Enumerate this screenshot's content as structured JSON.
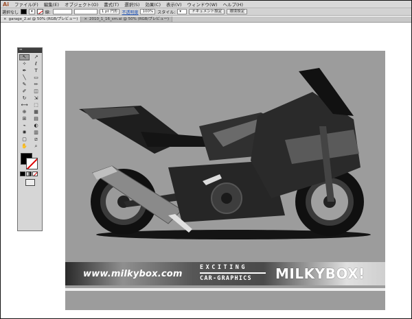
{
  "menubar": {
    "logo": "Ai",
    "items": [
      "ファイル(F)",
      "編集(E)",
      "オブジェクト(O)",
      "書式(T)",
      "選択(S)",
      "効果(C)",
      "表示(V)",
      "ウィンドウ(W)",
      "ヘルプ(H)"
    ]
  },
  "controlbar": {
    "selection_label": "選択なし",
    "stroke_label": "線:",
    "stroke_width": "1 pt 円形",
    "opacity_label": "不透明度",
    "opacity_value": "100%",
    "style_label": "スタイル:",
    "doc_setup_button": "ドキュメント設定",
    "preferences_button": "環境設定"
  },
  "tabs": [
    {
      "label": "garage_2.ai @ 50% (RGB/プレビュー)"
    },
    {
      "label": "2010_1_16_sm.ai @ 50% (RGB/プレビュー)"
    }
  ],
  "artwork": {
    "url": "www.milkybox.com",
    "tagline_1": "EXCITING",
    "tagline_2": "CAR-GRAPHICS",
    "brand": "MILKYBOX!"
  },
  "tools": [
    {
      "name": "selection-tool",
      "glyph": "↖"
    },
    {
      "name": "direct-selection-tool",
      "glyph": "↗"
    },
    {
      "name": "magic-wand-tool",
      "glyph": "✧"
    },
    {
      "name": "lasso-tool",
      "glyph": "ℓ"
    },
    {
      "name": "pen-tool",
      "glyph": "✒"
    },
    {
      "name": "type-tool",
      "glyph": "T"
    },
    {
      "name": "line-tool",
      "glyph": "╲"
    },
    {
      "name": "rectangle-tool",
      "glyph": "▭"
    },
    {
      "name": "paintbrush-tool",
      "glyph": "✎"
    },
    {
      "name": "pencil-tool",
      "glyph": "✏"
    },
    {
      "name": "blob-brush-tool",
      "glyph": "✐"
    },
    {
      "name": "eraser-tool",
      "glyph": "◫"
    },
    {
      "name": "rotate-tool",
      "glyph": "↻"
    },
    {
      "name": "scale-tool",
      "glyph": "⇲"
    },
    {
      "name": "width-tool",
      "glyph": "⟷"
    },
    {
      "name": "free-transform-tool",
      "glyph": "⬚"
    },
    {
      "name": "shape-builder-tool",
      "glyph": "⊕"
    },
    {
      "name": "perspective-grid-tool",
      "glyph": "▦"
    },
    {
      "name": "mesh-tool",
      "glyph": "⊞"
    },
    {
      "name": "gradient-tool",
      "glyph": "▤"
    },
    {
      "name": "eyedropper-tool",
      "glyph": "⌁"
    },
    {
      "name": "blend-tool",
      "glyph": "◐"
    },
    {
      "name": "symbol-sprayer-tool",
      "glyph": "✺"
    },
    {
      "name": "column-graph-tool",
      "glyph": "▥"
    },
    {
      "name": "artboard-tool",
      "glyph": "▢"
    },
    {
      "name": "slice-tool",
      "glyph": "⧄"
    },
    {
      "name": "hand-tool",
      "glyph": "✋"
    },
    {
      "name": "zoom-tool",
      "glyph": "⌕"
    }
  ],
  "colors": {
    "fill": "#000000",
    "stroke": "none"
  }
}
